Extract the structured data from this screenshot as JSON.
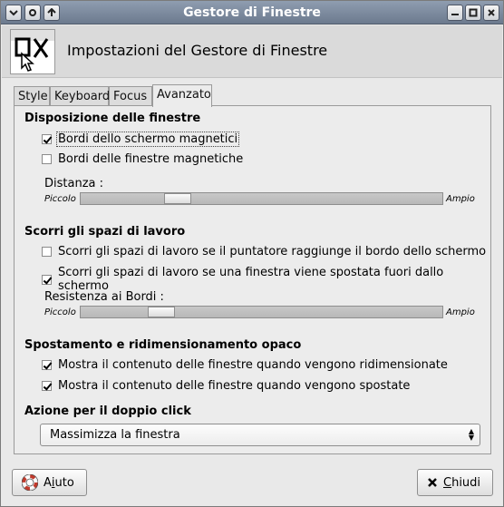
{
  "window": {
    "title": "Gestore di Finestre"
  },
  "header": {
    "title": "Impostazioni del Gestore di Finestre"
  },
  "tabs": [
    {
      "label": "Style"
    },
    {
      "label": "Keyboard"
    },
    {
      "label": "Focus"
    },
    {
      "label": "Avanzato",
      "active": true
    }
  ],
  "sections": {
    "disposizione": {
      "title": "Disposizione delle finestre",
      "opt1": {
        "label": "Bordi dello schermo magnetici",
        "checked": true
      },
      "opt2": {
        "label": "Bordi delle finestre magnetiche",
        "checked": false
      },
      "slider": {
        "label": "Distanza :",
        "min_label": "Piccolo",
        "max_label": "Ampio",
        "value_fraction": 0.25
      }
    },
    "scorri": {
      "title": "Scorri gli spazi di lavoro",
      "opt1": {
        "label": "Scorri gli spazi di lavoro se il puntatore raggiunge il bordo dello schermo",
        "checked": false
      },
      "opt2": {
        "label": "Scorri gli spazi di lavoro se una finestra viene spostata fuori dallo schermo",
        "checked": true
      },
      "slider": {
        "label": "Resistenza ai Bordi :",
        "min_label": "Piccolo",
        "max_label": "Ampio",
        "value_fraction": 0.2
      }
    },
    "opaco": {
      "title": "Spostamento e ridimensionamento opaco",
      "opt1": {
        "label": "Mostra il contenuto delle finestre quando vengono ridimensionate",
        "checked": true
      },
      "opt2": {
        "label": "Mostra il contenuto delle finestre quando vengono spostate",
        "checked": true
      }
    },
    "doppio": {
      "title": "Azione per il doppio click",
      "selected": "Massimizza la finestra"
    }
  },
  "buttons": {
    "help_prefix": "A",
    "help_mnemonic": "i",
    "help_suffix": "uto",
    "close_mnemonic": "C",
    "close_suffix": "hiudi"
  },
  "icons": {
    "menu": "chevron-down-icon",
    "stick": "circle-icon",
    "shade": "arrow-up-icon",
    "minimize": "minimize-icon",
    "maximize": "maximize-icon",
    "close": "close-icon",
    "app": "window-manager-icon",
    "help": "lifebuoy-icon",
    "close_btn": "x-icon"
  }
}
